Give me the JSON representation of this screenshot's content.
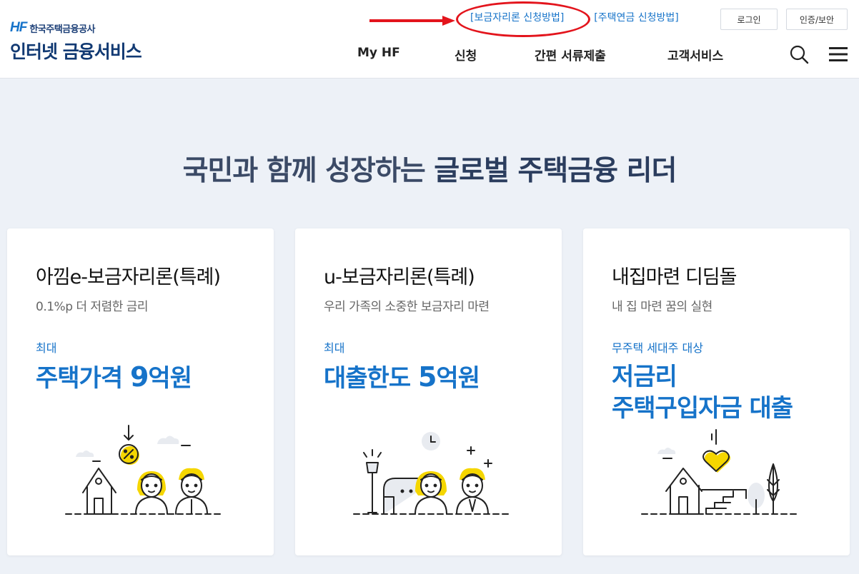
{
  "header": {
    "logo": {
      "mark": "HF",
      "company": "한국주택금융공사",
      "service": "인터넷 금융서비스"
    },
    "util_links": [
      "[보금자리론 신청방법]",
      "[주택연금 신청방법]"
    ],
    "buttons": {
      "login": "로그인",
      "cert": "인증/보안"
    },
    "nav": [
      "My HF",
      "신청",
      "간편 서류제출",
      "고객서비스"
    ],
    "icons": {
      "search": "search-icon",
      "menu": "hamburger-menu-icon"
    }
  },
  "hero": {
    "title_regular": "국민과 함께 성장하는 ",
    "title_strong": "글로벌 주택금융 리더"
  },
  "cards": [
    {
      "title": "아낌e-보금자리론(특례)",
      "subtitle": "0.1%p 더 저렴한 금리",
      "caption": "최대",
      "highlight_pre": "주택가격 ",
      "highlight_num": "9",
      "highlight_post": "억원"
    },
    {
      "title": "u-보금자리론(특례)",
      "subtitle": "우리 가족의 소중한 보금자리 마련",
      "caption": "최대",
      "highlight_pre": "대출한도 ",
      "highlight_num": "5",
      "highlight_post": "억원"
    },
    {
      "title": "내집마련 디딤돌",
      "subtitle": "내 집 마련 꿈의 실현",
      "caption": "무주택 세대주 대상",
      "highlight_line1": "저금리",
      "highlight_line2": "주택구입자금 대출"
    }
  ],
  "colors": {
    "accent": "#1673c9",
    "navy": "#123a73",
    "highlight_yellow": "#f5d600",
    "callout_red": "#e3141c",
    "page_bg": "#edf1f7"
  }
}
